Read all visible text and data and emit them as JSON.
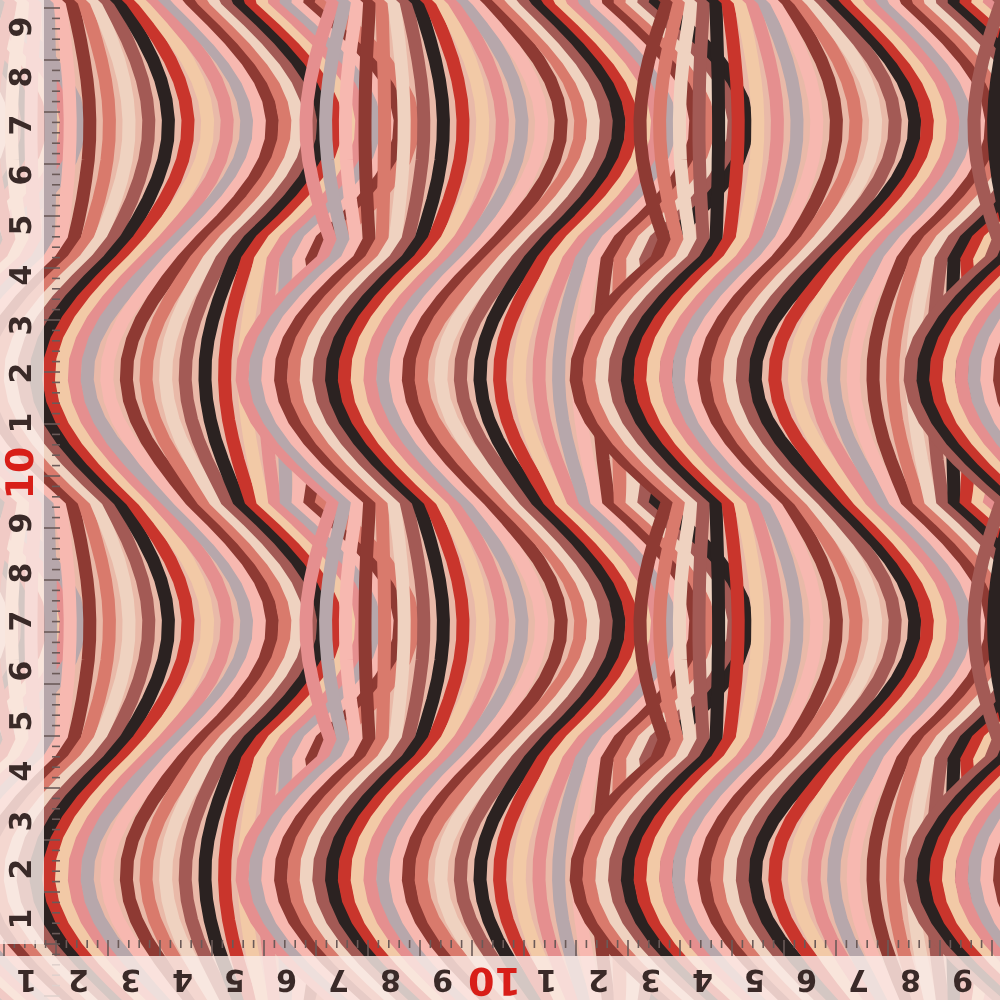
{
  "photo": {
    "kind": "marbled-fabric"
  },
  "left_ruler": {
    "labels": [
      {
        "text": "1",
        "kind": "minor"
      },
      {
        "text": "2",
        "kind": "minor"
      },
      {
        "text": "3",
        "kind": "minor"
      },
      {
        "text": "4",
        "kind": "minor"
      },
      {
        "text": "5",
        "kind": "minor"
      },
      {
        "text": "6",
        "kind": "minor"
      },
      {
        "text": "7",
        "kind": "minor"
      },
      {
        "text": "8",
        "kind": "minor"
      },
      {
        "text": "9",
        "kind": "minor"
      },
      {
        "text": "10",
        "kind": "major"
      },
      {
        "text": "1",
        "kind": "minor"
      },
      {
        "text": "2",
        "kind": "minor"
      },
      {
        "text": "3",
        "kind": "minor"
      },
      {
        "text": "4",
        "kind": "minor"
      },
      {
        "text": "5",
        "kind": "minor"
      },
      {
        "text": "6",
        "kind": "minor"
      },
      {
        "text": "7",
        "kind": "minor"
      },
      {
        "text": "8",
        "kind": "minor"
      },
      {
        "text": "9",
        "kind": "minor"
      }
    ]
  },
  "bottom_ruler": {
    "labels": [
      {
        "text": "1",
        "kind": "minor"
      },
      {
        "text": "2",
        "kind": "minor"
      },
      {
        "text": "3",
        "kind": "minor"
      },
      {
        "text": "4",
        "kind": "minor"
      },
      {
        "text": "5",
        "kind": "minor"
      },
      {
        "text": "6",
        "kind": "minor"
      },
      {
        "text": "7",
        "kind": "minor"
      },
      {
        "text": "8",
        "kind": "minor"
      },
      {
        "text": "9",
        "kind": "minor"
      },
      {
        "text": "10",
        "kind": "major"
      },
      {
        "text": "1",
        "kind": "minor"
      },
      {
        "text": "2",
        "kind": "minor"
      },
      {
        "text": "3",
        "kind": "minor"
      },
      {
        "text": "4",
        "kind": "minor"
      },
      {
        "text": "5",
        "kind": "minor"
      },
      {
        "text": "6",
        "kind": "minor"
      },
      {
        "text": "7",
        "kind": "minor"
      },
      {
        "text": "8",
        "kind": "minor"
      },
      {
        "text": "9",
        "kind": "minor"
      }
    ]
  }
}
